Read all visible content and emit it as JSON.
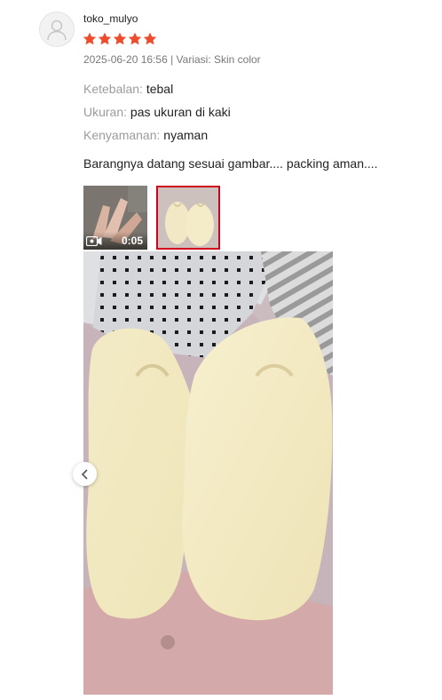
{
  "review": {
    "username": "toko_mulyo",
    "rating": 5,
    "meta": "2025-06-20 16:56 | Variasi: Skin color",
    "attributes": [
      {
        "key": "Ketebalan:",
        "value": "tebal"
      },
      {
        "key": "Ukuran:",
        "value": "pas ukuran di kaki"
      },
      {
        "key": "Kenyamanan:",
        "value": "nyaman"
      }
    ],
    "comment": "Barangnya datang sesuai gambar.... packing aman....",
    "media": {
      "video_duration": "0:05",
      "selected_index": 1
    }
  },
  "colors": {
    "star": "#ee4d2d",
    "selected_border": "#d0011b",
    "muted_text": "rgba(0,0,0,0.4)"
  },
  "icons": {
    "avatar": "default-user-icon",
    "star": "star-icon",
    "video": "video-camera-icon",
    "prev": "chevron-left-icon"
  }
}
